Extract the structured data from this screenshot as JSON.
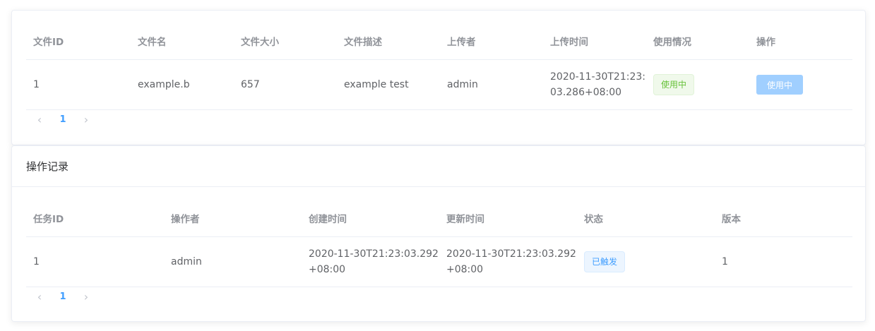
{
  "files": {
    "columns": [
      "文件ID",
      "文件名",
      "文件大小",
      "文件描述",
      "上传者",
      "上传时间",
      "使用情况",
      "操作"
    ],
    "rows": [
      {
        "id": "1",
        "name": "example.b",
        "size": "657",
        "description": "example test",
        "uploader": "admin",
        "upload_time_line1": "2020-11-30T21:23:",
        "upload_time_line2": "03.286+08:00",
        "usage": "使用中",
        "action_label": "使用中"
      }
    ],
    "pagination": {
      "prev": "‹",
      "current": "1",
      "next": "›"
    }
  },
  "records": {
    "title": "操作记录",
    "columns": [
      "任务ID",
      "操作者",
      "创建时间",
      "更新时间",
      "状态",
      "版本"
    ],
    "rows": [
      {
        "task_id": "1",
        "operator": "admin",
        "created_line1": "2020-11-30T21:23:03.292",
        "created_line2": "+08:00",
        "updated_line1": "2020-11-30T21:23:03.292",
        "updated_line2": "+08:00",
        "status": "已触发",
        "version": "1"
      }
    ],
    "pagination": {
      "prev": "‹",
      "current": "1",
      "next": "›"
    }
  },
  "colors": {
    "primary": "#409eff",
    "success": "#67c23a",
    "header_text": "#909399",
    "body_text": "#606266",
    "disabled_button": "#a0cfff"
  }
}
